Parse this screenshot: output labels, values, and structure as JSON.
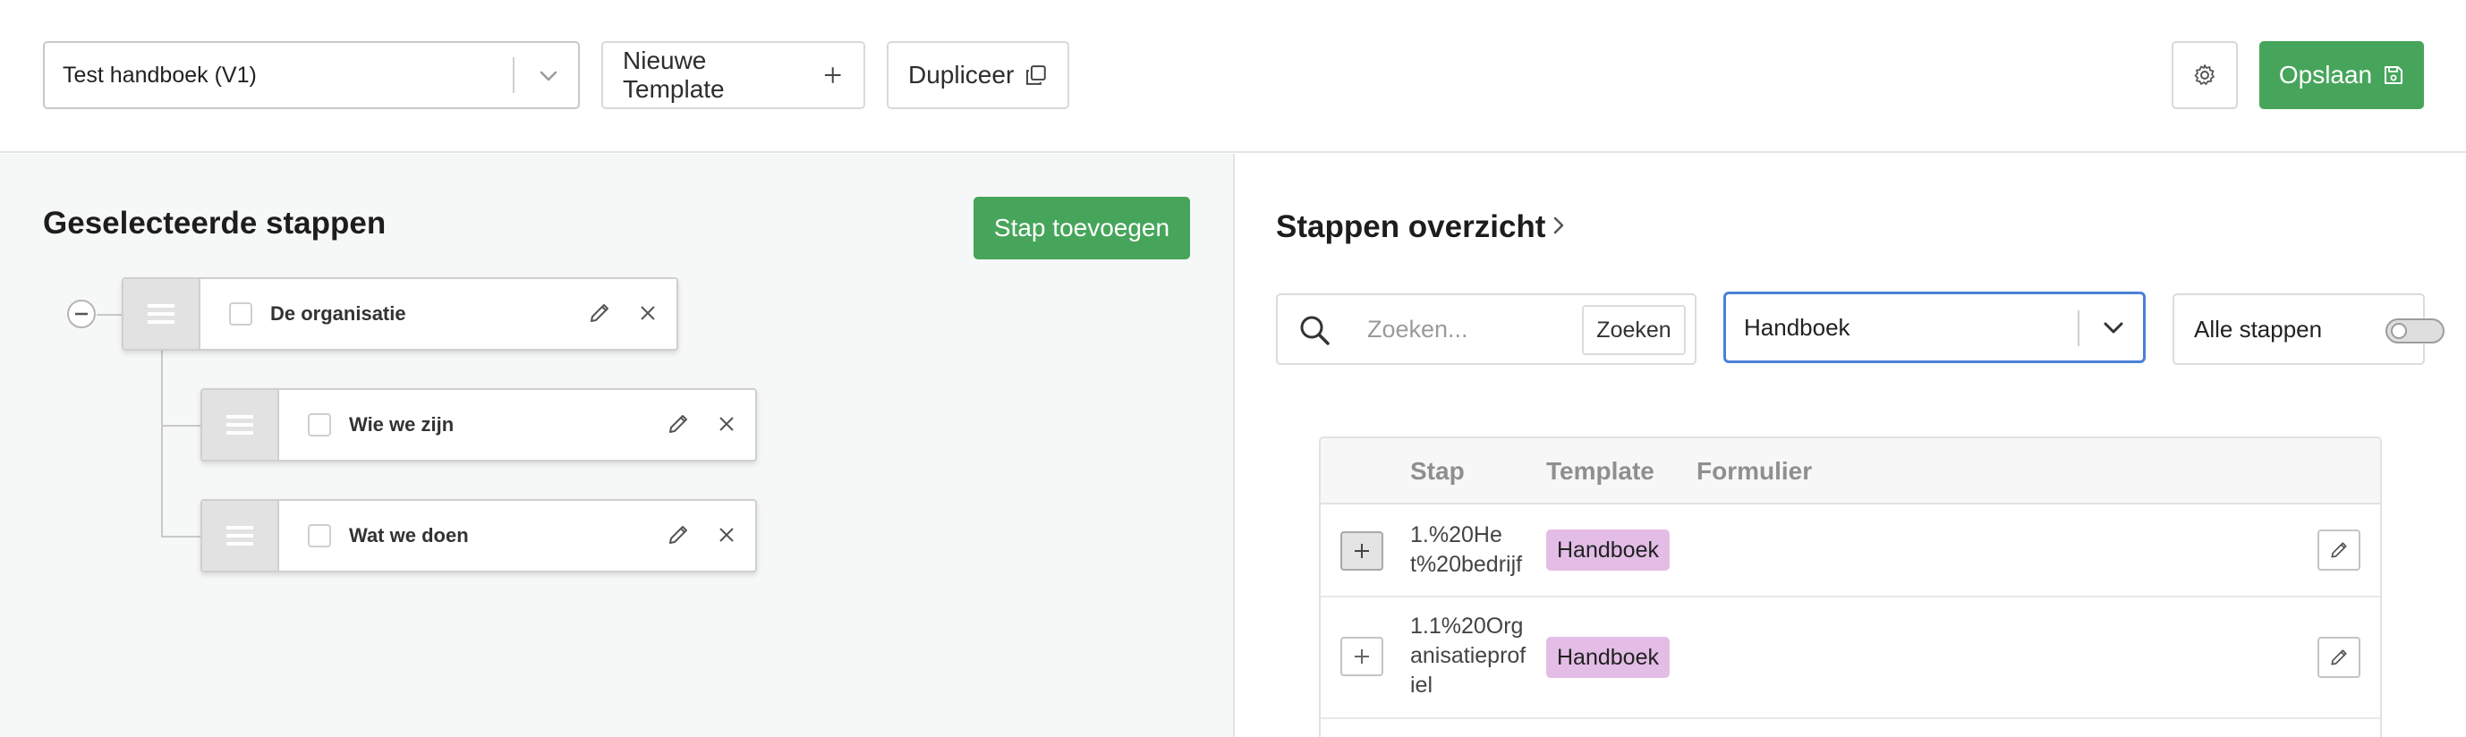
{
  "toolbar": {
    "template_select": {
      "value": "Test handboek (V1)",
      "icon": "chevron-down-icon"
    },
    "new_template_label": "Nieuwe Template",
    "duplicate_label": "Dupliceer",
    "settings_icon": "gear-icon",
    "save_label": "Opslaan",
    "colors": {
      "primary_green": "#47a55b"
    }
  },
  "left_panel": {
    "title": "Geselecteerde stappen",
    "add_step_label": "Stap toevoegen",
    "steps": [
      {
        "label": "De organisatie",
        "level": 0,
        "checked": false
      },
      {
        "label": "Wie we zijn",
        "level": 1,
        "checked": false
      },
      {
        "label": "Wat we doen",
        "level": 1,
        "checked": false
      }
    ]
  },
  "right_panel": {
    "title": "Stappen overzicht",
    "search": {
      "placeholder": "Zoeken...",
      "value": "",
      "button_label": "Zoeken"
    },
    "filter_select": {
      "value": "Handboek"
    },
    "toggle": {
      "label": "Alle stappen",
      "on": false
    },
    "table": {
      "columns": [
        "Stap",
        "Template",
        "Formulier"
      ],
      "rows": [
        {
          "stap": "1.%20Het%20bedrijf",
          "template": "Handboek",
          "formulier": ""
        },
        {
          "stap": "1.1%20Organisatieprofiel",
          "template": "Handboek",
          "formulier": ""
        }
      ]
    },
    "colors": {
      "badge": "#e3bde6",
      "focus_border": "#4a80d8"
    }
  }
}
